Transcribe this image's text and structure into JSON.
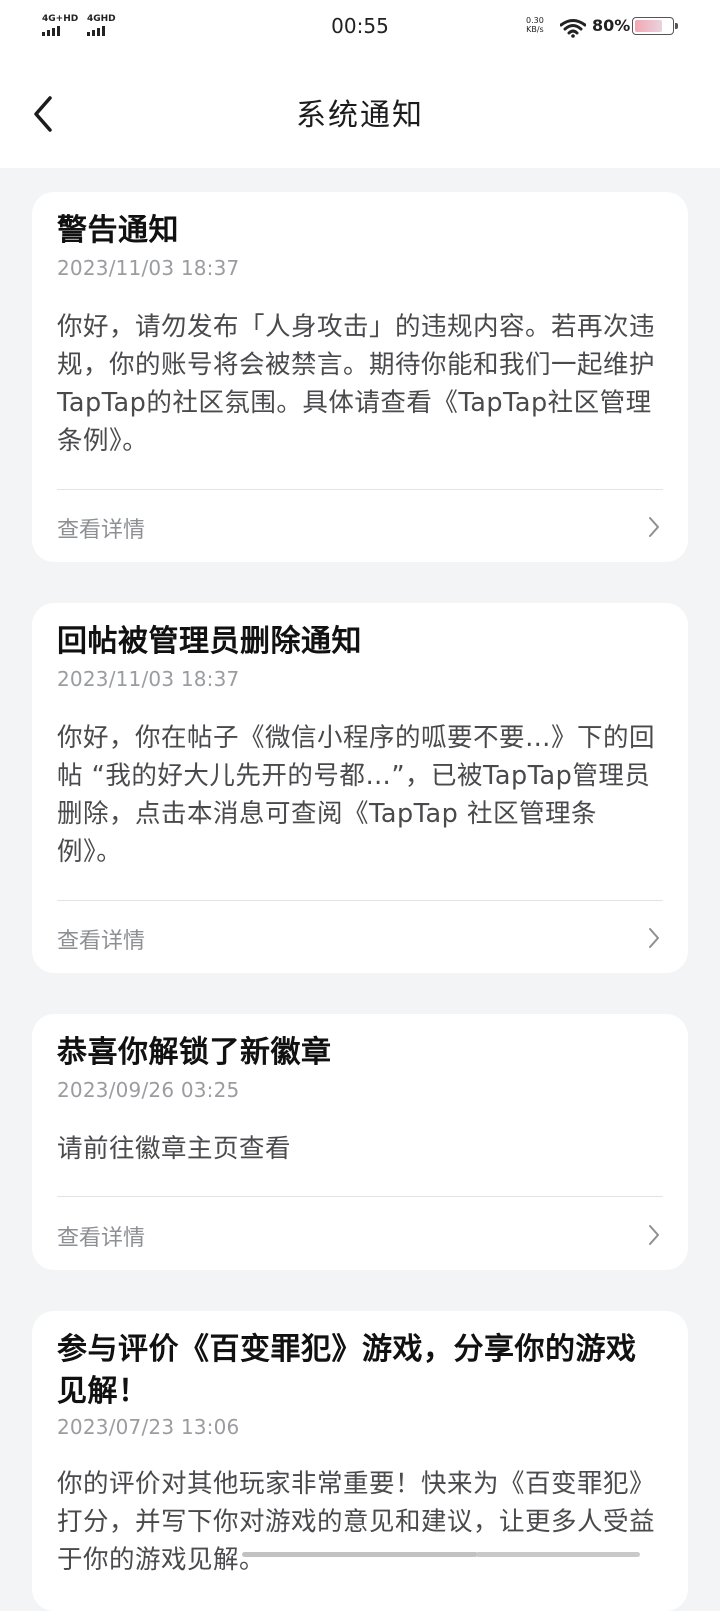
{
  "status": {
    "signal1": "4G+HD",
    "signal2": "4GHD",
    "time": "00:55",
    "net_speed_value": "0.30",
    "net_speed_unit": "KB/s",
    "battery_text": "80%",
    "battery_level": 0.8
  },
  "nav": {
    "back_icon": "chevron-left-icon",
    "title": "系统通知"
  },
  "notifications": [
    {
      "title": "警告通知",
      "time": "2023/11/03 18:37",
      "body": "你好，请勿发布「人身攻击」的违规内容。若再次违规，你的账号将会被禁言。期待你能和我们一起维护TapTap的社区氛围。具体请查看《TapTap社区管理条例》。",
      "detail_label": "查看详情"
    },
    {
      "title": "回帖被管理员删除通知",
      "time": "2023/11/03 18:37",
      "body": "你好，你在帖子《微信小程序的呱要不要…》下的回帖 “我的好大儿先开的号都…”，已被TapTap管理员删除，点击本消息可查阅《TapTap 社区管理条例》。",
      "detail_label": "查看详情"
    },
    {
      "title": "恭喜你解锁了新徽章",
      "time": "2023/09/26 03:25",
      "body": "请前往徽章主页查看",
      "detail_label": "查看详情"
    },
    {
      "title": "参与评价《百变罪犯》游戏，分享你的游戏见解！",
      "time": "2023/07/23 13:06",
      "body": "你的评价对其他玩家非常重要！快来为《百变罪犯》打分，并写下你对游戏的意见和建议，让更多人受益于你的游戏见解。"
    }
  ]
}
